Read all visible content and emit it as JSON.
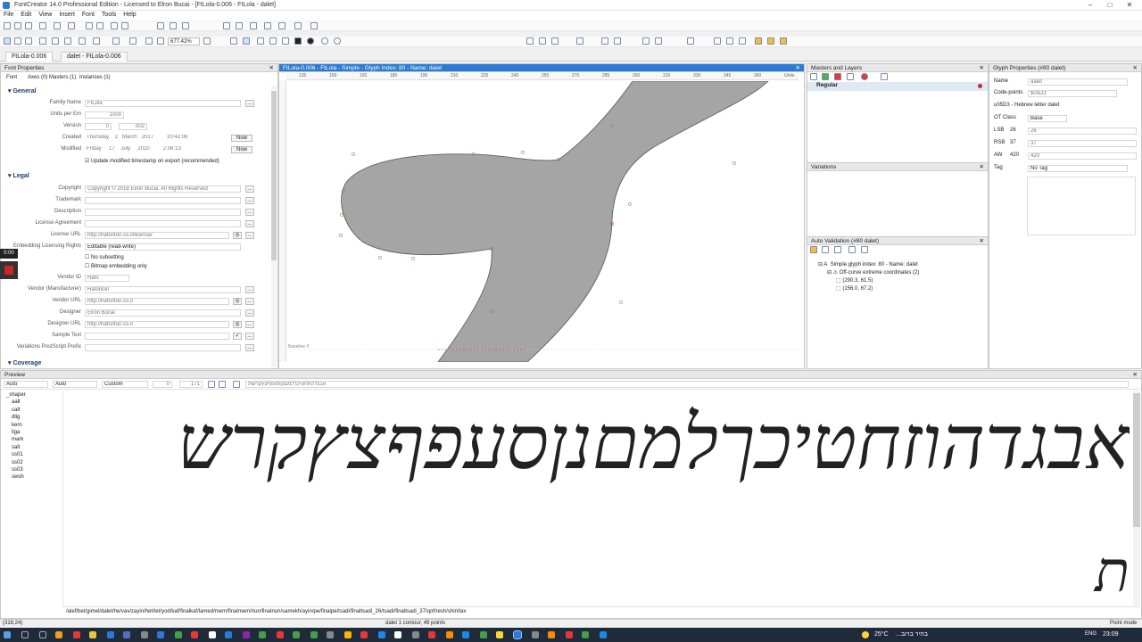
{
  "app": {
    "title": "FontCreator 14.0 Professional Edition - Licensed to Elron Bucai - [FtLola-0.006 - FtLola - dalet]"
  },
  "menu": [
    "File",
    "Edit",
    "View",
    "Insert",
    "Font",
    "Tools",
    "Help"
  ],
  "toolbar": {
    "zoom": "677.42%"
  },
  "tabs": [
    {
      "label": "FtLola-0.006"
    },
    {
      "label": "dalet - FtLola-0.006"
    }
  ],
  "font_properties": {
    "title": "Font Properties",
    "subtabs": [
      "Font",
      "Axes (0)",
      "Masters (1)",
      "Instances (1)"
    ],
    "general_label": "General",
    "family_name_label": "Family Name",
    "family_name": "FtLola",
    "upm_label": "Units per Em",
    "upm": "1000",
    "version_label": "Version",
    "version_major": "0",
    "version_minor": "002",
    "created_label": "Created",
    "created_day": "Thursday",
    "created_date": "2",
    "created_month": "March",
    "created_year": "2017",
    "created_time": "20:42:06",
    "modified_label": "Modified",
    "modified_day": "Friday",
    "modified_date": "17",
    "modified_month": "July",
    "modified_year": "2020",
    "modified_time": "2:06:13",
    "now_label": "Now",
    "update_ts_label": "Update modified timestamp on export (recommended)",
    "legal_label": "Legal",
    "copyright_label": "Copyright",
    "copyright": "Copyright © 2018 Elron Bucai. All Rights Reserved",
    "trademark_label": "Trademark",
    "description_label": "Description",
    "license_agreement_label": "License Agreement",
    "license_url_label": "License URL",
    "license_url": "http://hafonton.co.il/license/",
    "embedding_label": "Embedding Licensing Rights",
    "embedding": "Editable (read-write)",
    "no_subsetting_label": "No subsetting",
    "bitmap_label": "Bitmap embedding only",
    "vendor_id_label": "Vendor ID",
    "vendor_id": "Hafo",
    "vendor_mfr_label": "Vendor (Manufacturer)",
    "vendor_mfr": "Hafonton",
    "vendor_url_label": "Vendor URL",
    "vendor_url": "http://hafonton.co.il",
    "designer_label": "Designer",
    "designer": "Elron Bucai",
    "designer_url_label": "Designer URL",
    "designer_url": "http://hafonton.co.il",
    "sample_text_label": "Sample Text",
    "ps_prefix_label": "Variations PostScript Prefix",
    "coverage_label": "Coverage"
  },
  "timer": "0:00",
  "glyph_editor": {
    "title": "FtLola-0.006 - FtLola - Simple - Glyph Index: 80 - Name: dalet",
    "ruler": [
      "135",
      "150",
      "165",
      "180",
      "195",
      "210",
      "225",
      "240",
      "255",
      "270",
      "285",
      "300",
      "315",
      "330",
      "345",
      "360"
    ],
    "baseline": "Baseline 0",
    "units": "Units"
  },
  "masters_layers": {
    "title": "Masters and Layers",
    "layer": "Regular"
  },
  "variations": {
    "title": "Variations"
  },
  "auto_validation": {
    "title": "Auto Validation (#80 dalet)",
    "item": "Simple glyph index: 80 - Name: dalet",
    "sub": "Off-curve extreme coordinates (2)",
    "coords": [
      "(290.3, 61.5)",
      "(156.0, 67.2)"
    ]
  },
  "glyph_properties": {
    "title": "Glyph Properties (#80 dalet)",
    "name_label": "Name",
    "name": "dalet",
    "codepoints_label": "Code-points",
    "codepoints": "$05D3",
    "desc": "u05D3 - Hebrew letter dalet",
    "ot_class_label": "OT Class",
    "ot_class": "Base",
    "lsb_label": "LSB",
    "lsb": "26",
    "lsb2": "26",
    "rsb_label": "RSB",
    "rsb": "37",
    "rsb2": "37",
    "aw_label": "AW",
    "aw": "420",
    "aw2": "420",
    "tag_label": "Tag",
    "tag": "No Tag"
  },
  "preview": {
    "title": "Preview",
    "dir": "Auto",
    "script": "Auto",
    "mode": "Custom",
    "size1": "0",
    "size2": "171",
    "text_field": "אבגדהוזחטיכךלמםנןסעפףצץקרשת",
    "features": [
      "_shaper",
      "aalt",
      "calt",
      "dlig",
      "kern",
      "liga",
      "mark",
      "salt",
      "ss01",
      "ss02",
      "ss03",
      "swsh"
    ],
    "line1": "אבגדהוזחטיכךלמםנןסעפףצץקרש",
    "line2": "ת",
    "glyphnames": "/alef/bet/gimel/dalet/he/vav/zayin/het/tet/yod/kaf/finalkaf/lamed/mem/finalmem/nun/finalnun/samekh/ayin/pe/finalpe/tsadi/finaltsadi_26/tsadi/finaltsadi_37/qof/resh/shin/tav"
  },
  "status": {
    "coords": "(318,24)",
    "glyph": "dalet  1 contour, 49 points",
    "mode": "Point mode"
  },
  "taskbar": {
    "temp": "25°C",
    "weather": "בהיר ברוב...",
    "lang": "ENG",
    "time": "23:09"
  },
  "colors": {
    "accent": "#2b7bd6",
    "glyph_fill": "#a5a5a5"
  }
}
